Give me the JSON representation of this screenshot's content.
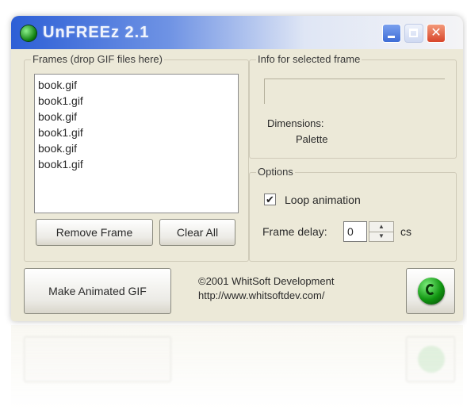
{
  "window": {
    "title": "UnFREEz 2.1",
    "controls": {
      "minimize_icon": "minimize-icon",
      "maximize_icon": "maximize-icon",
      "close_icon": "close-icon",
      "close_glyph": "✕"
    }
  },
  "frames": {
    "group_label": "Frames (drop GIF files here)",
    "items": [
      "book.gif",
      "book1.gif",
      "book.gif",
      "book1.gif",
      "book.gif",
      "book1.gif"
    ],
    "remove_label": "Remove Frame",
    "clear_label": "Clear All"
  },
  "info": {
    "group_label": "Info for selected frame",
    "dimensions_label": "Dimensions:",
    "palette_label": "Palette"
  },
  "options": {
    "group_label": "Options",
    "loop_checked": true,
    "loop_check_glyph": "✔",
    "loop_label": "Loop animation",
    "delay_label": "Frame delay:",
    "delay_value": "0",
    "delay_unit": "cs",
    "spin_up_glyph": "▲",
    "spin_down_glyph": "▼"
  },
  "footer": {
    "make_label": "Make Animated GIF",
    "copyright_line1": "©2001 WhitSoft Development",
    "copyright_line2": "http://www.whitsoftdev.com/",
    "go_icon": "go-icon"
  },
  "colors": {
    "window_bg": "#ece9d8",
    "titlebar_blue": "#2d5fd6",
    "close_red": "#d8452a",
    "go_green": "#109510"
  }
}
